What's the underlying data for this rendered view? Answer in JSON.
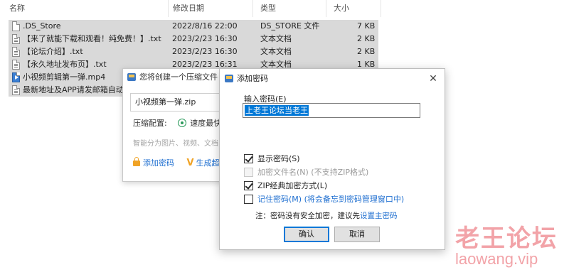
{
  "explorer": {
    "columns": {
      "name": "名称",
      "modified": "修改日期",
      "type": "类型",
      "size": "大小"
    },
    "files": [
      {
        "name": ".DS_Store",
        "date": "2022/8/16 22:00",
        "type": "DS_STORE 文件",
        "size": "7 KB",
        "icon": "file-icon"
      },
      {
        "name": "【来了就能下载和观看！纯免费！】.txt",
        "date": "2023/2/23 16:30",
        "type": "文本文档",
        "size": "2 KB",
        "icon": "text-file-icon"
      },
      {
        "name": "【论坛介绍】.txt",
        "date": "2023/2/23 16:30",
        "type": "文本文档",
        "size": "2 KB",
        "icon": "text-file-icon"
      },
      {
        "name": "【永久地址发布页】.txt",
        "date": "2023/2/23 16:31",
        "type": "文本文档",
        "size": "1 KB",
        "icon": "text-file-icon"
      },
      {
        "name": "小视频剪辑第一弹.mp4",
        "date": "",
        "type": "",
        "size": "",
        "icon": "video-file-icon"
      },
      {
        "name": "最新地址及APP请发邮箱自动",
        "date": "",
        "type": "",
        "size": "",
        "icon": "text-file-icon"
      }
    ]
  },
  "compress_dialog": {
    "title": "您将创建一个压缩文件 -",
    "filename": "小视频第一弹.zip",
    "config_label": "压缩配置:",
    "config_value": "速度最快",
    "hint": "智能分为图片、视频、文档",
    "add_password": "添加密码",
    "generate": "生成超"
  },
  "password_dialog": {
    "title": "添加密码",
    "input_label": "输入密码(E)",
    "password_value": "上老王论坛当老王",
    "options": {
      "show_password": {
        "label": "显示密码(S)",
        "checked": true
      },
      "encrypt_names": {
        "label": "加密文件名(N) (不支持ZIP格式)",
        "checked": false
      },
      "zip_classic": {
        "label": "ZIP经典加密方式(L)",
        "checked": true
      },
      "remember": {
        "label": "记住密码(M) (将会备忘到密码管理窗口中)",
        "checked": false
      }
    },
    "note_prefix": "注：密码没有安全加密，建议先",
    "note_link": "设置主密码",
    "ok": "确认",
    "cancel": "取消"
  },
  "watermark": {
    "main": "老王论坛",
    "sub": "laowang.vip"
  },
  "colors": {
    "selection_bg": "#d9d9d9",
    "accent_blue": "#0078d7",
    "link_blue": "#1f6fd0",
    "watermark": "#f2a3a8"
  }
}
